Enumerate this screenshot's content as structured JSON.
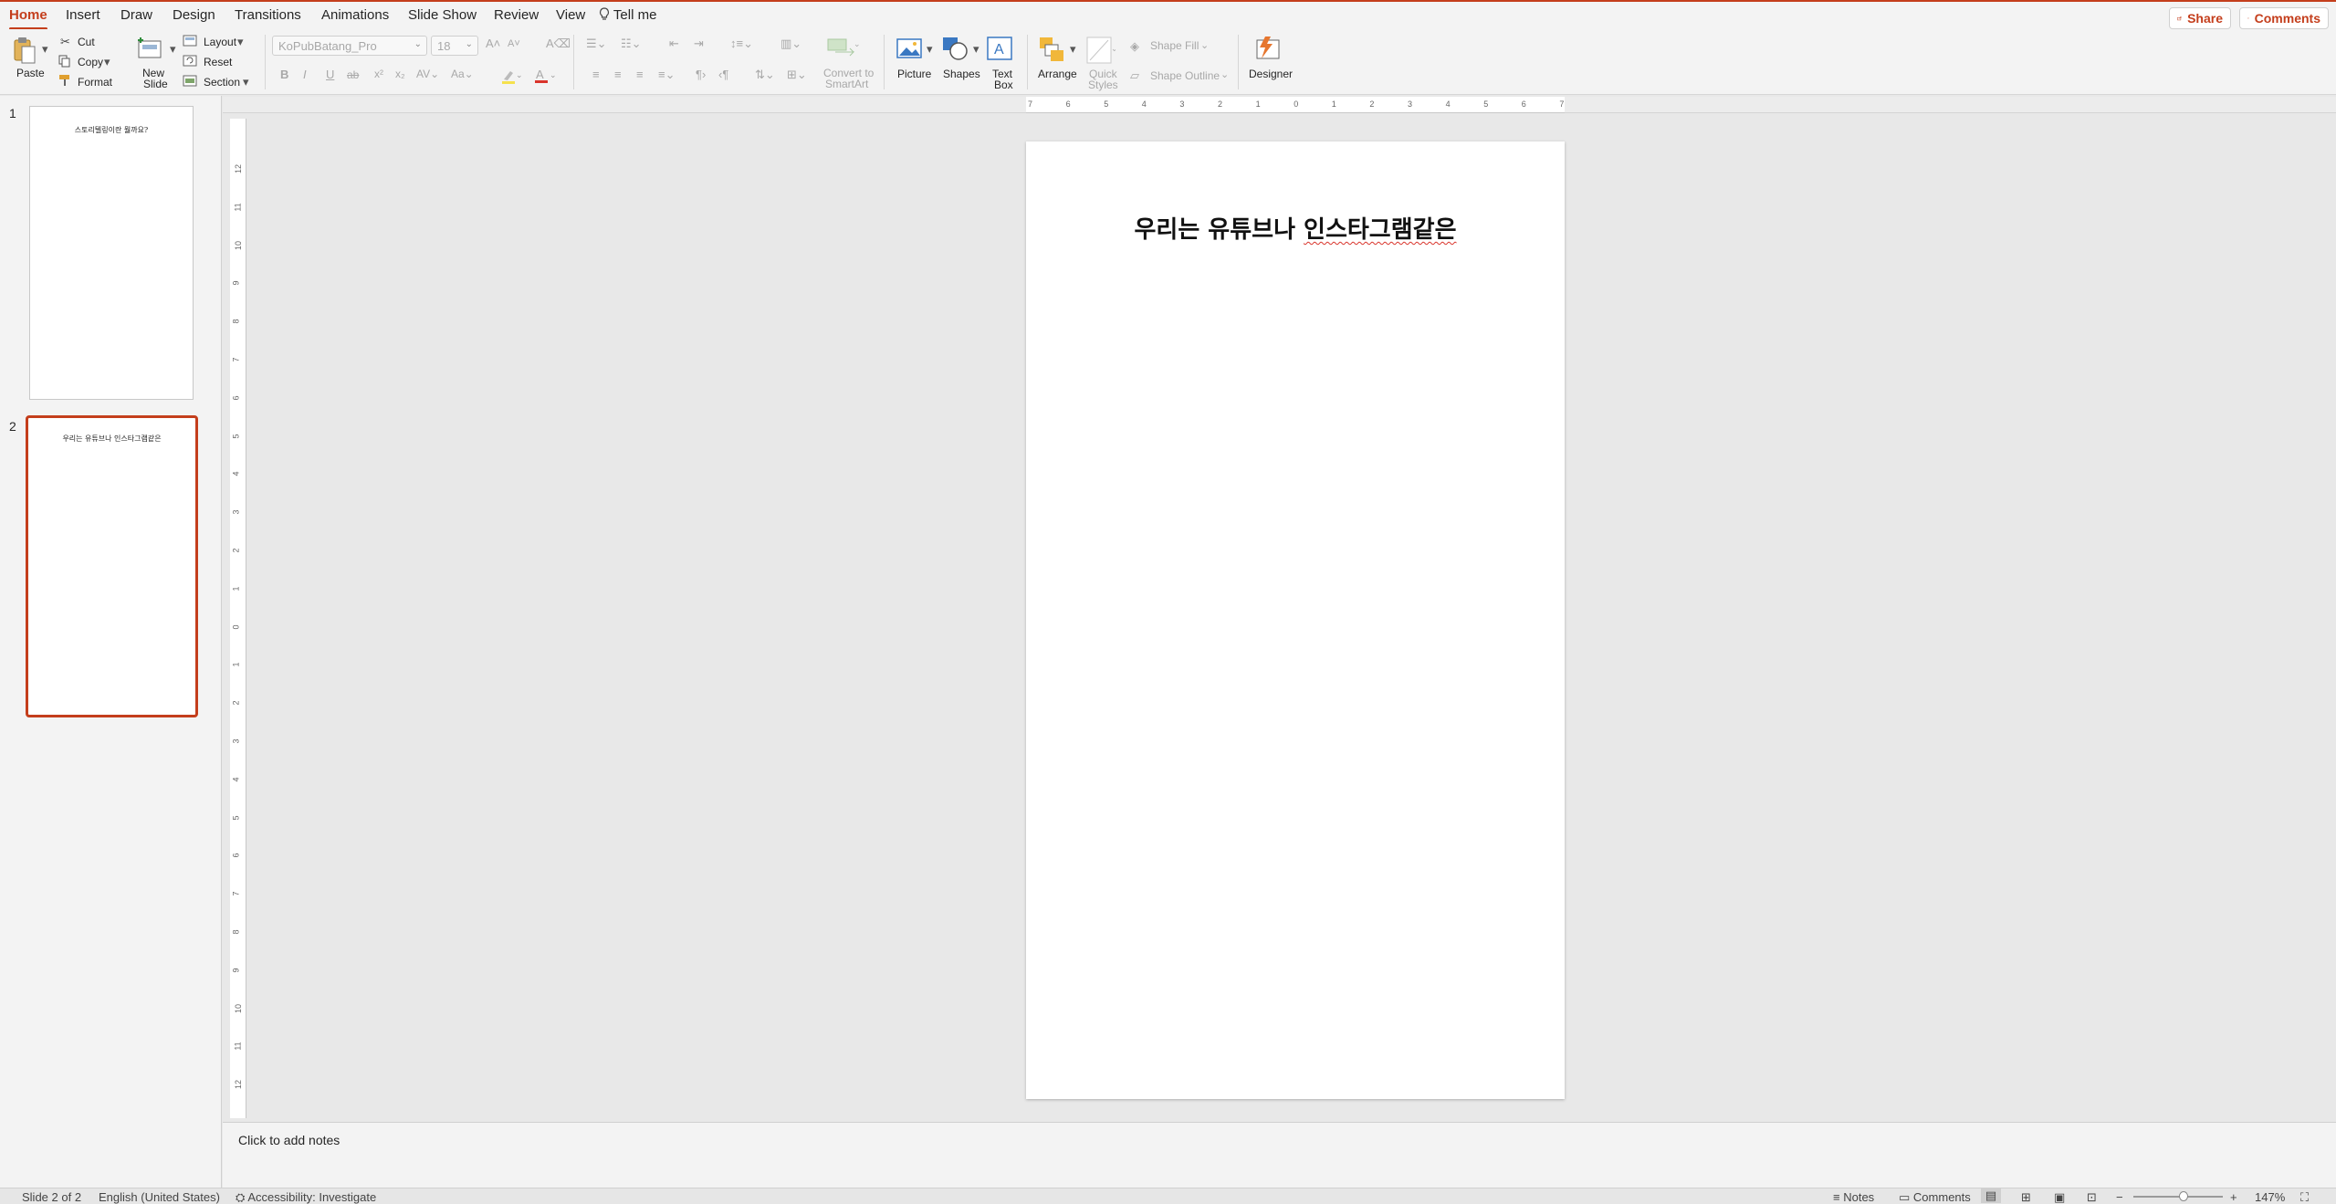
{
  "menu": {
    "tabs": [
      "Home",
      "Insert",
      "Draw",
      "Design",
      "Transitions",
      "Animations",
      "Slide Show",
      "Review",
      "View"
    ],
    "tell_me": "Tell me",
    "share": "Share",
    "comments": "Comments"
  },
  "ribbon": {
    "paste": "Paste",
    "cut": "Cut",
    "copy": "Copy",
    "format": "Format",
    "new_slide": [
      "New",
      "Slide"
    ],
    "layout": "Layout",
    "reset": "Reset",
    "section": "Section",
    "font_name": "KoPubBatang_Pro",
    "font_size": "18",
    "convert_smartart": [
      "Convert to",
      "SmartArt"
    ],
    "picture": "Picture",
    "shapes": "Shapes",
    "text_box": [
      "Text",
      "Box"
    ],
    "arrange": "Arrange",
    "quick_styles": [
      "Quick",
      "Styles"
    ],
    "shape_fill": "Shape Fill",
    "shape_outline": "Shape Outline",
    "designer": "Designer"
  },
  "thumbnails": [
    {
      "number": "1",
      "title": "스토리텔링이란 뭘까요?"
    },
    {
      "number": "2",
      "title": "우리는 유튜브나 인스타그램같은"
    }
  ],
  "slide": {
    "title_main": "우리는 유튜브나 ",
    "title_flagged": "인스타그램같은"
  },
  "notes": {
    "placeholder": "Click to add notes"
  },
  "status": {
    "slide_pos": "Slide 2 of 2",
    "language": "English (United States)",
    "accessibility": "Accessibility: Investigate",
    "notes": "Notes",
    "comments": "Comments",
    "zoom": "147%"
  },
  "colors": {
    "accent": "#c43e1c"
  }
}
